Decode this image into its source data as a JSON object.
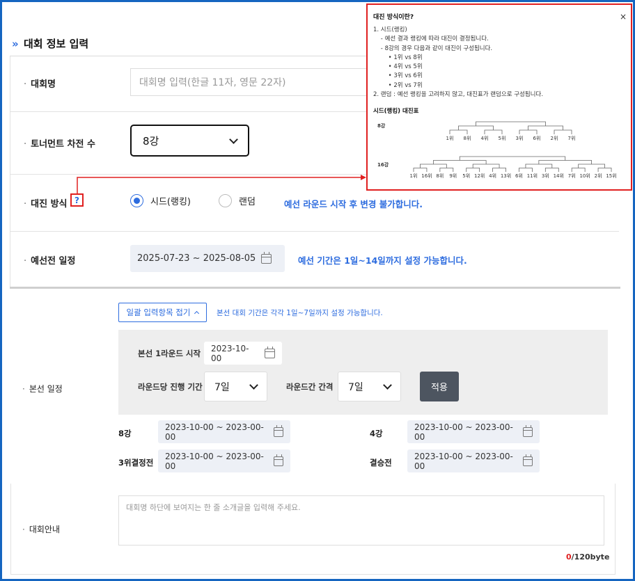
{
  "section_title": "대회 정보 입력",
  "fields": {
    "name_label": "대회명",
    "name_placeholder": "대회명 입력(한글 11자, 영문 22자)",
    "rounds_label": "토너먼트 차전 수",
    "rounds_value": "8강",
    "match_label": "대진 방식",
    "help_glyph": "?",
    "radio_seed": "시드(랭킹)",
    "radio_random": "랜덤",
    "match_note": "예선 라운드 시작 후 변경 불가합니다.",
    "prelim_label": "예선전 일정",
    "prelim_range": "2025-07-23 ~ 2025-08-05",
    "prelim_note": "예선 기간은 1일~14일까지 설정 가능합니다.",
    "main_label": "본선 일정",
    "collapse_label": "일괄 입력항목 접기",
    "main_note": "본선 대회 기간은 각각 1일~7일까지 설정 가능합니다.",
    "round1_label": "본선 1라운드 시작",
    "round1_value": "2023-10-00",
    "per_round_label": "라운드당 진행 기간",
    "per_round_value": "7일",
    "interval_label": "라운드간 간격",
    "interval_value": "7일",
    "apply_label": "적용",
    "intro_label": "대회안내",
    "intro_placeholder": "대회명 하단에 보여지는 한 줄 소개글을 입력해 주세요.",
    "bytes_count": "0",
    "bytes_max": "/120byte"
  },
  "rounds": [
    {
      "label": "8강",
      "range": "2023-10-00 ~ 2023-00-00"
    },
    {
      "label": "4강",
      "range": "2023-10-00 ~ 2023-00-00"
    },
    {
      "label": "3위결정전",
      "range": "2023-10-00 ~ 2023-00-00"
    },
    {
      "label": "결승전",
      "range": "2023-10-00 ~ 2023-00-00"
    }
  ],
  "popup": {
    "title": "대진 방식이란?",
    "close": "×",
    "lines": [
      "1. 시드(랭킹)",
      "  - 예선 결과 랭킹에 따라 대진이 결정됩니다.",
      "  - 8강의 경우 다음과 같이 대진이 구성됩니다.",
      "    •  1위 vs 8위",
      "    •  4위 vs 5위",
      "    •  3위 vs 6위",
      "    •  2위 vs 7위",
      "2. 랜덤 : 예선 랭킹을 고려하지 않고, 대진표가 랜덤으로 구성됩니다."
    ],
    "bracket_title": "시드(랭킹) 대진표",
    "bracket8_label": "8강",
    "bracket8": [
      "1위",
      "8위",
      "4위",
      "5위",
      "3위",
      "6위",
      "2위",
      "7위"
    ],
    "bracket16_label": "16강",
    "bracket16": [
      "1위",
      "16위",
      "8위",
      "9위",
      "5위",
      "12위",
      "4위",
      "13위",
      "6위",
      "11위",
      "3위",
      "14위",
      "7위",
      "10위",
      "2위",
      "15위"
    ]
  },
  "colors": {
    "accent": "#2d6cdf",
    "highlight_red": "#e02020",
    "frame_blue": "#1565c0",
    "apply_button": "#4d5560"
  }
}
